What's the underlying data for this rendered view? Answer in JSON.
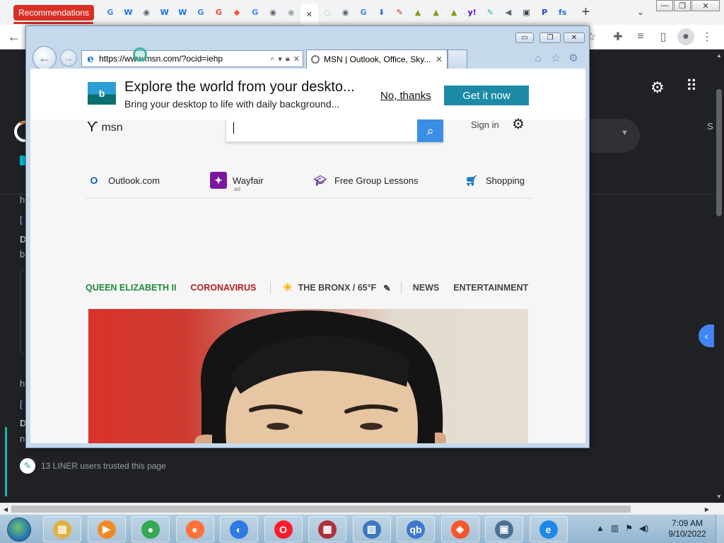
{
  "chrome": {
    "tab_group_label": "Recommendations",
    "pinned_tabs": [
      {
        "icon": "google-icon",
        "glyph": "G",
        "color": "#4285f4"
      },
      {
        "icon": "wikipedia-icon",
        "glyph": "W",
        "color": "#1a73e8"
      },
      {
        "icon": "globe-icon",
        "glyph": "◉",
        "color": "#5f6368"
      },
      {
        "icon": "wikipedia-icon",
        "glyph": "W",
        "color": "#1a73e8"
      },
      {
        "icon": "wikipedia-icon",
        "glyph": "W",
        "color": "#1a73e8"
      },
      {
        "icon": "google-icon",
        "glyph": "G",
        "color": "#4285f4"
      },
      {
        "icon": "google-icon",
        "glyph": "G",
        "color": "#ea4335"
      },
      {
        "icon": "brave-icon",
        "glyph": "◆",
        "color": "#fb542b"
      },
      {
        "icon": "google-icon",
        "glyph": "G",
        "color": "#4285f4"
      },
      {
        "icon": "globe-icon",
        "glyph": "◉",
        "color": "#5f6368"
      },
      {
        "icon": "globe-icon",
        "glyph": "◉",
        "color": "#9aa0a6"
      },
      {
        "icon": "close-icon",
        "glyph": "✕",
        "color": "#3c4043",
        "active": true
      },
      {
        "icon": "loading-icon",
        "glyph": "◌",
        "color": "#9aa0a6"
      },
      {
        "icon": "globe-icon",
        "glyph": "◉",
        "color": "#5f6368"
      },
      {
        "icon": "google-icon",
        "glyph": "G",
        "color": "#4285f4"
      },
      {
        "icon": "download-icon",
        "glyph": "⬇",
        "color": "#1a73e8"
      },
      {
        "icon": "pdf-icon",
        "glyph": "✎",
        "color": "#d93025"
      },
      {
        "icon": "lamp-icon",
        "glyph": "▲",
        "color": "#8a9a16"
      },
      {
        "icon": "lamp-icon",
        "glyph": "▲",
        "color": "#8a9a16"
      },
      {
        "icon": "lamp-icon",
        "glyph": "▲",
        "color": "#8a9a16"
      },
      {
        "icon": "yahoo-icon",
        "glyph": "y!",
        "color": "#6001d2"
      },
      {
        "icon": "liner-icon",
        "glyph": "✎",
        "color": "#20b2aa"
      },
      {
        "icon": "speaker-icon",
        "glyph": "◀",
        "color": "#5f6368"
      },
      {
        "icon": "printer-icon",
        "glyph": "▣",
        "color": "#3c4043"
      },
      {
        "icon": "pbs-icon",
        "glyph": "P",
        "color": "#2638c4"
      },
      {
        "icon": "fs-icon",
        "glyph": "fs",
        "color": "#1a73e8"
      }
    ]
  },
  "ie": {
    "address": "https://www.msn.com/?ocid=iehp",
    "tab_title": "MSN | Outlook, Office, Sky...",
    "banner": {
      "title": "Explore the world from your deskto...",
      "subtitle": "Bring your desktop to life with daily background...",
      "no_thanks": "No, thanks",
      "get_it": "Get it now"
    },
    "msn": {
      "logo_text": "msn",
      "sign_in": "Sign in"
    },
    "quicklinks": [
      {
        "label": "Outlook.com",
        "icon": "outlook-icon"
      },
      {
        "label": "Wayfair",
        "sub": "ad",
        "icon": "wayfair-icon"
      },
      {
        "label": "Free Group Lessons",
        "icon": "graduation-cap-icon"
      },
      {
        "label": "Shopping",
        "icon": "shopping-cart-icon"
      }
    ],
    "nav": {
      "queen": "QUEEN ELIZABETH II",
      "corona": "CORONAVIRUS",
      "weather": "THE BRONX / 65°F",
      "news": "NEWS",
      "entertainment": "ENTERTAINMENT"
    }
  },
  "page": {
    "liner_note": "13 LINER users trusted this page",
    "fragments": {
      "h1": "h",
      "b1": "[",
      "d1": "D",
      "bb": "b",
      "h2": "h",
      "b2": "[",
      "d2": "D",
      "n2": "n",
      "s": "S"
    }
  },
  "taskbar": {
    "apps": [
      {
        "name": "file-explorer",
        "glyph": "▤",
        "color": "#e0b040"
      },
      {
        "name": "media-player",
        "glyph": "▶",
        "color": "#f08a24"
      },
      {
        "name": "chrome",
        "glyph": "●",
        "color": "#34a853"
      },
      {
        "name": "firefox",
        "glyph": "●",
        "color": "#ff7139"
      },
      {
        "name": "avast-browser",
        "glyph": "◐",
        "color": "#2d7ae0"
      },
      {
        "name": "opera",
        "glyph": "O",
        "color": "#ff1b2d"
      },
      {
        "name": "winrar",
        "glyph": "▦",
        "color": "#b0303a"
      },
      {
        "name": "control-panel",
        "glyph": "▧",
        "color": "#3d78c0"
      },
      {
        "name": "qbittorrent",
        "glyph": "qb",
        "color": "#3f78c9"
      },
      {
        "name": "brave",
        "glyph": "◆",
        "color": "#fb542b"
      },
      {
        "name": "network-computer",
        "glyph": "▣",
        "color": "#4d6f92"
      },
      {
        "name": "internet-explorer",
        "glyph": "e",
        "color": "#1e88e5"
      }
    ],
    "time": "7:09 AM",
    "date": "9/10/2022"
  }
}
